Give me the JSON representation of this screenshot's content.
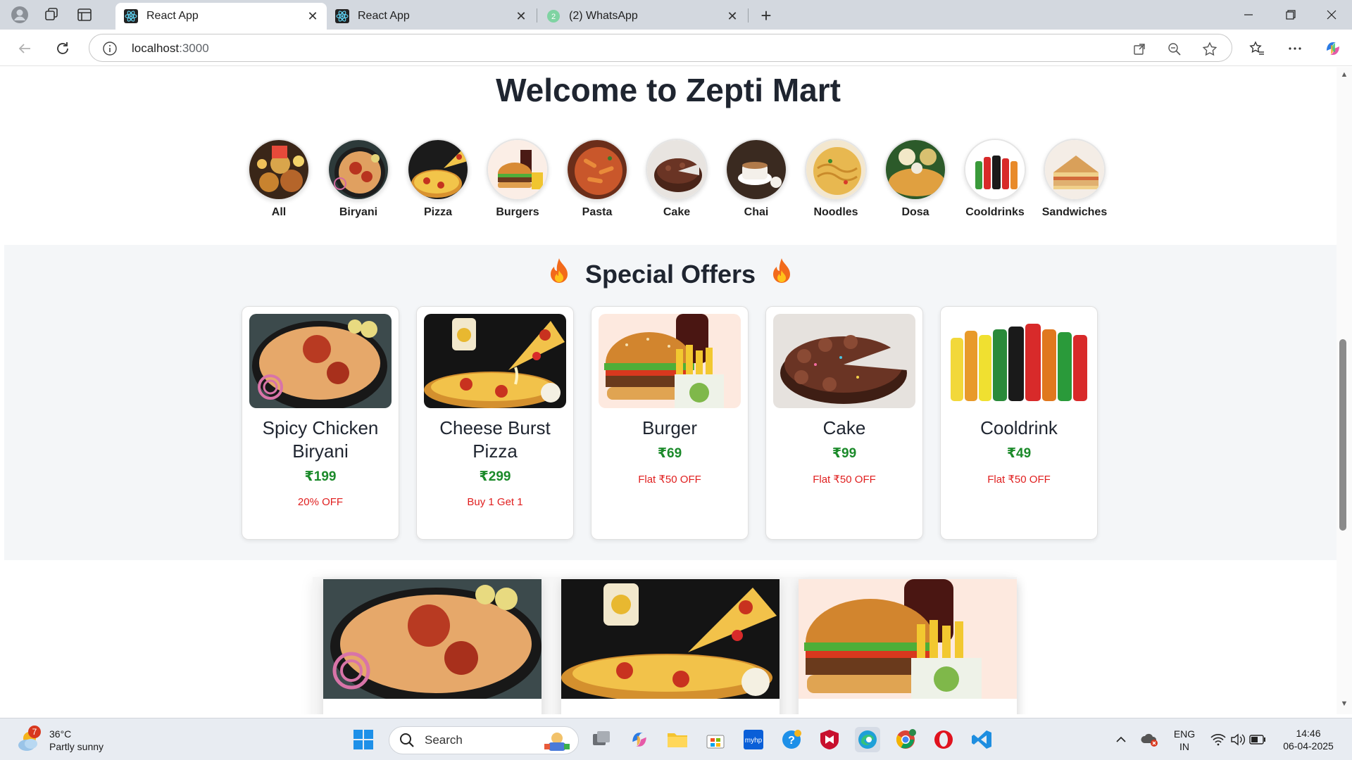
{
  "browser": {
    "tabs": [
      {
        "title": "React App",
        "active": true
      },
      {
        "title": "React App",
        "active": false
      },
      {
        "title": "(2) WhatsApp",
        "active": false
      }
    ],
    "address": {
      "host": "localhost",
      "port": ":3000"
    }
  },
  "page": {
    "welcome": "Welcome to Zepti Mart",
    "categories": [
      {
        "name": "All",
        "icon": "all-food-image"
      },
      {
        "name": "Biryani",
        "icon": "biryani-image"
      },
      {
        "name": "Pizza",
        "icon": "pizza-image"
      },
      {
        "name": "Burgers",
        "icon": "burger-image"
      },
      {
        "name": "Pasta",
        "icon": "pasta-image"
      },
      {
        "name": "Cake",
        "icon": "cake-image"
      },
      {
        "name": "Chai",
        "icon": "chai-image"
      },
      {
        "name": "Noodles",
        "icon": "noodles-image"
      },
      {
        "name": "Dosa",
        "icon": "dosa-image"
      },
      {
        "name": "Cooldrinks",
        "icon": "cooldrinks-image"
      },
      {
        "name": "Sandwiches",
        "icon": "sandwich-image"
      }
    ],
    "offers": {
      "title": "Special Offers",
      "items": [
        {
          "name": "Spicy Chicken Biryani",
          "price": "₹199",
          "deal": "20% OFF"
        },
        {
          "name": "Cheese Burst Pizza",
          "price": "₹299",
          "deal": "Buy 1 Get 1"
        },
        {
          "name": "Burger",
          "price": "₹69",
          "deal": "Flat ₹50 OFF"
        },
        {
          "name": "Cake",
          "price": "₹99",
          "deal": "Flat ₹50 OFF"
        },
        {
          "name": "Cooldrink",
          "price": "₹49",
          "deal": "Flat ₹50 OFF"
        }
      ]
    },
    "products": [
      {
        "icon": "biryani-image"
      },
      {
        "icon": "pizza-image"
      },
      {
        "icon": "burger-image"
      }
    ]
  },
  "taskbar": {
    "weather": {
      "temp": "36°C",
      "desc": "Partly sunny",
      "badge": "7"
    },
    "search_label": "Search",
    "lang": {
      "line1": "ENG",
      "line2": "IN"
    },
    "clock": {
      "time": "14:46",
      "date": "06-04-2025"
    }
  },
  "colors": {
    "price": "#1b8a2a",
    "deal": "#e01e1e",
    "heading": "#1f2530"
  }
}
